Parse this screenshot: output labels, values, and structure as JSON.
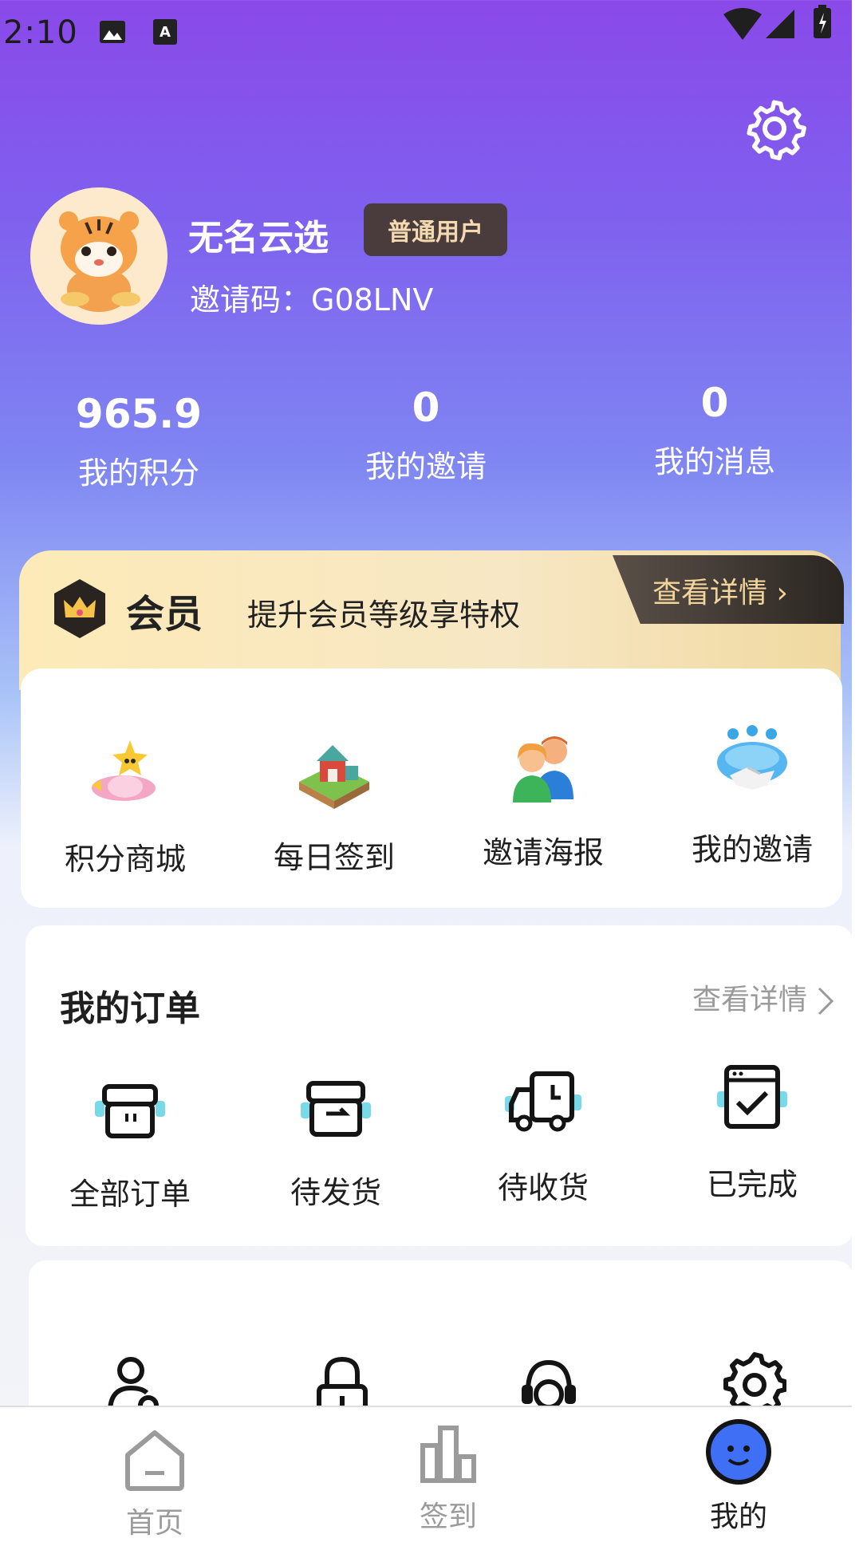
{
  "status_bar": {
    "time": "2:10"
  },
  "profile": {
    "nickname": "无名云选",
    "badge": "普通用户",
    "invite_code": "邀请码：G08LNV"
  },
  "stats": [
    {
      "value": "965.9",
      "label": "我的积分"
    },
    {
      "value": "0",
      "label": "我的邀请"
    },
    {
      "value": "0",
      "label": "我的消息"
    }
  ],
  "member": {
    "title": "会员",
    "subtitle": "提升会员等级享特权",
    "detail": "查看详情 ›"
  },
  "quick_actions": [
    {
      "label": "积分商城",
      "icon": "points-mall-icon"
    },
    {
      "label": "每日签到",
      "icon": "daily-checkin-icon"
    },
    {
      "label": "邀请海报",
      "icon": "invite-poster-icon"
    },
    {
      "label": "我的邀请",
      "icon": "my-invites-icon"
    }
  ],
  "orders": {
    "title": "我的订单",
    "detail": "查看详情",
    "items": [
      {
        "label": "全部订单",
        "icon": "all-orders-icon"
      },
      {
        "label": "待发货",
        "icon": "pending-shipment-icon"
      },
      {
        "label": "待收货",
        "icon": "pending-delivery-icon"
      },
      {
        "label": "已完成",
        "icon": "completed-icon"
      }
    ]
  },
  "tools": [
    {
      "icon": "account-settings-icon"
    },
    {
      "icon": "lock-icon"
    },
    {
      "icon": "customer-service-icon"
    },
    {
      "icon": "settings-icon"
    }
  ],
  "nav": [
    {
      "label": "首页",
      "icon": "home-icon"
    },
    {
      "label": "签到",
      "icon": "checkin-icon"
    },
    {
      "label": "我的",
      "icon": "mine-icon",
      "active": true
    }
  ],
  "colors": {
    "accent": "#7f60ee",
    "badge_bg": "#4a3c3c",
    "badge_text": "#f3d9b0",
    "member_gold": "#f2d59b"
  }
}
